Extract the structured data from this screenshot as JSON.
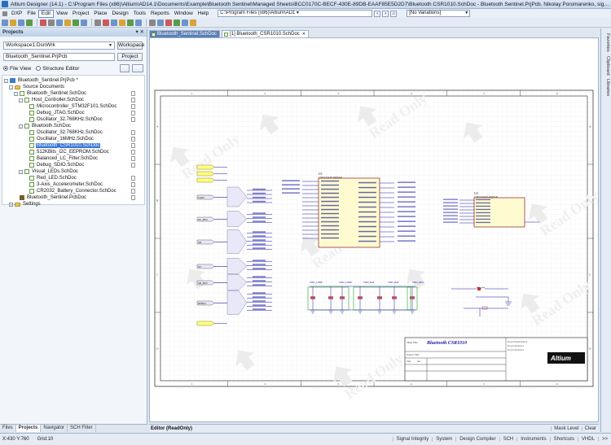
{
  "window": {
    "title": "Altium Designer (14.1) - C:\\Program Files (x86)\\Altium\\AD14.1\\Documents\\Example\\Bluetooth Sentinel\\Managed Sheets\\BCC0170C-BECF-430E-89DB-EAAF85E5D2D7\\Bluetooth CSR1010.SchDoc - Bluetooth Sentinel.PrjPcb. Nikolay Poromarenko, signed in."
  },
  "menu": {
    "items": [
      "DXP",
      "File",
      "Edit",
      "View",
      "Project",
      "Place",
      "Design",
      "Tools",
      "Reports",
      "Window",
      "Help"
    ],
    "active": "Edit",
    "path": "C:\\Program Files (x86)\\Altium\\AD1 ▾",
    "variants": "[No Variations]"
  },
  "projects_panel": {
    "title": "Projects",
    "workspace_value": "Workspace1.DsnWrk",
    "workspace_button": "Workspace",
    "project_value": "Bluetooth_Sentinel.PrjPcb",
    "project_button": "Project",
    "file_view": "File View",
    "structure_editor": "Structure Editor",
    "tree": [
      {
        "label": "Bluetooth_Sentinel.PrjPcb *",
        "icon": "project-icon",
        "exp": "-"
      },
      {
        "label": "Source Documents",
        "icon": "folder-icon",
        "exp": "-"
      },
      {
        "label": "Bluetooth_Sentinel.SchDoc",
        "icon": "schematic-icon",
        "exp": "-"
      },
      {
        "label": "Host_Controller.SchDoc",
        "icon": "schematic-icon",
        "exp": "-"
      },
      {
        "label": "Microcontroller_STM32F101.SchDoc",
        "icon": "schematic-icon",
        "exp": ""
      },
      {
        "label": "Debug_JTAG.SchDoc",
        "icon": "schematic-icon",
        "exp": ""
      },
      {
        "label": "Oscillator_32.768KHz.SchDoc",
        "icon": "schematic-icon",
        "exp": ""
      },
      {
        "label": "Bluetooth.SchDoc",
        "icon": "schematic-icon",
        "exp": "-"
      },
      {
        "label": "Oscillator_32.768KHz.SchDoc",
        "icon": "schematic-icon",
        "exp": ""
      },
      {
        "label": "Oscillator_16MHz.SchDoc",
        "icon": "schematic-icon",
        "exp": ""
      },
      {
        "label": "Bluetooth_CSR1010.SchDoc",
        "icon": "schematic-icon",
        "exp": "",
        "selected": true
      },
      {
        "label": "512KBits_I2C_EEPROM.SchDoc",
        "icon": "schematic-icon",
        "exp": ""
      },
      {
        "label": "Balanced_LC_Filter.SchDoc",
        "icon": "schematic-icon",
        "exp": ""
      },
      {
        "label": "Debug_SDIO.SchDoc",
        "icon": "schematic-icon",
        "exp": ""
      },
      {
        "label": "Visual_LEDs.SchDoc",
        "icon": "schematic-icon",
        "exp": "-"
      },
      {
        "label": "Red_LED.SchDoc",
        "icon": "schematic-icon",
        "exp": ""
      },
      {
        "label": "3-Axis_Accelerometer.SchDoc",
        "icon": "schematic-icon",
        "exp": ""
      },
      {
        "label": "CR2032_Battery_Connector.SchDoc",
        "icon": "schematic-icon",
        "exp": ""
      },
      {
        "label": "Bluetooth_Sentinel.PcbDoc",
        "icon": "pcb-icon",
        "exp": ""
      },
      {
        "label": "Settings",
        "icon": "folder-icon",
        "exp": "+"
      }
    ],
    "bottom_tabs": [
      "Files",
      "Projects",
      "Navigator",
      "SCH Filter"
    ],
    "active_tab": "Projects"
  },
  "doc_tabs": [
    "Bluetooth_Sentinel.SchDoc",
    "[1] Bluetooth_CSR1010.SchDoc"
  ],
  "sheet": {
    "chip_u1_ref": "U1",
    "chip_u1_name": "CSR1010A05-IQQM-R",
    "chip_u2_ref": "U2",
    "chip_u2_name": "CSR1010A05-IQQM-R",
    "ports_left": [
      "UART",
      "I2C_BUS",
      "SPI",
      "I2C",
      "SPI_BUS",
      "DEBUG",
      "DEBUG_SPI",
      "PIO",
      "SDA",
      "RF_IN"
    ],
    "caps_labels": [
      "VDD_CORE",
      "VDD_CORE",
      "VDD_BAT",
      "VDD_BAT",
      "VDD_PAD"
    ],
    "watermark": "Read Only",
    "title_block": {
      "title_label": "Sheet Title",
      "title": "Bluetooth CSR1010",
      "proj_label": "Project Title",
      "size_label": "Size",
      "size": "A4",
      "logo": "Altium",
      "org": "ProjectOrganization",
      "addr1": "ProjectAddress1",
      "addr2": "ProjectAddress2"
    },
    "grid_numbers": [
      "1",
      "2",
      "3",
      "4",
      "5",
      "6"
    ],
    "grid_letters": [
      "A",
      "B",
      "C",
      "D"
    ]
  },
  "editor": {
    "label": "Editor (ReadOnly)",
    "right": [
      "Mask Level",
      "Clear"
    ]
  },
  "right_panel_tabs": [
    "Favorites",
    "Clipboard",
    "Libraries"
  ],
  "status": {
    "coords": "X:430 Y:760",
    "grid": "Grid:10",
    "items": [
      "Signal Integrity",
      "System",
      "Design Compiler",
      "SCH",
      "Instruments",
      "Shortcuts",
      "VHDL",
      ">>"
    ]
  },
  "colors": {
    "wire": "#1a1aa8",
    "component": "#b33",
    "chip_fill": "#fffbd1",
    "port_fill": "#e8e8f8",
    "net_label": "#1a1aa8",
    "selection": "#3875d7"
  }
}
